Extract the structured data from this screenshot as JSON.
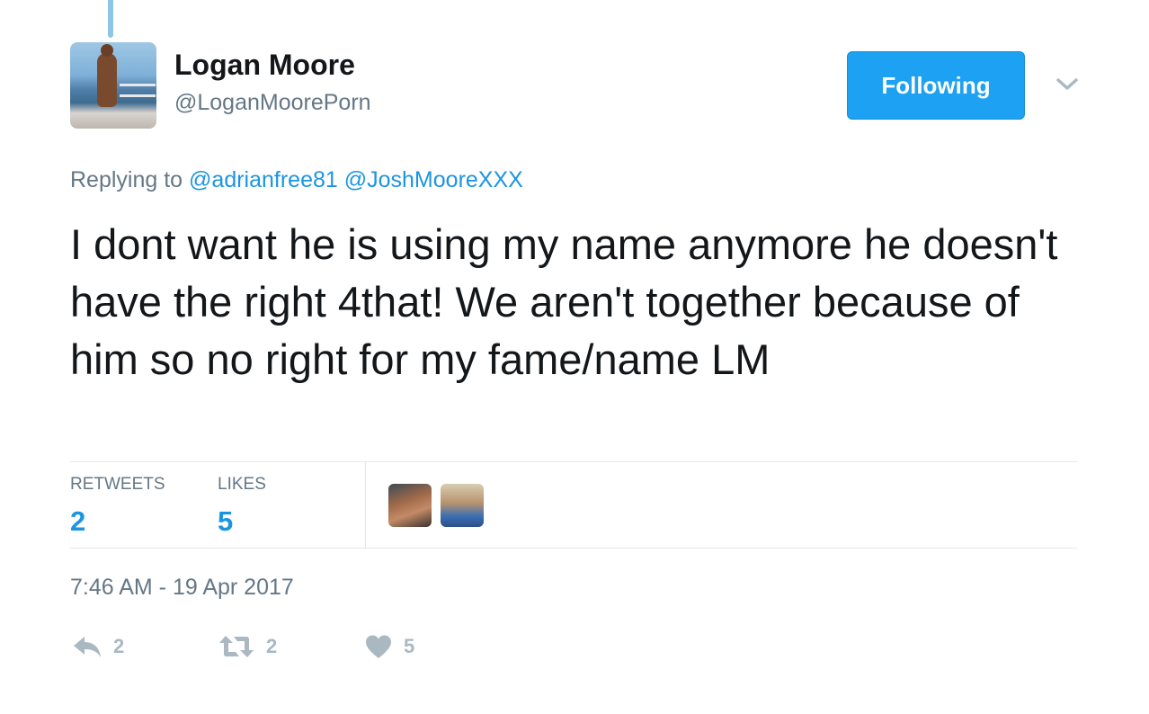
{
  "tweet": {
    "author": {
      "display_name": "Logan Moore",
      "screen_name": "@LoganMoorePorn"
    },
    "follow_button": {
      "label": "Following"
    },
    "reply_context": {
      "prefix": "Replying to",
      "mentions": [
        "@adrianfree81",
        "@JoshMooreXXX"
      ]
    },
    "text": "I dont want he is using my name anymore he doesn't have the right 4that! We aren't together because of him so no right for my fame/name LM",
    "stats": {
      "retweets_label": "RETWEETS",
      "retweets_value": "2",
      "likes_label": "LIKES",
      "likes_value": "5"
    },
    "timestamp": "7:46 AM - 19 Apr 2017",
    "actions": {
      "reply_count": "2",
      "retweet_count": "2",
      "like_count": "5"
    }
  },
  "colors": {
    "accent": "#1da1f2",
    "link": "#1b95e0",
    "muted": "#657786",
    "icon": "#aab8c2",
    "thread_line": "#8fc6e6"
  },
  "icons": {
    "caret": "chevron-down-icon",
    "reply": "reply-icon",
    "retweet": "retweet-icon",
    "like": "heart-icon"
  }
}
